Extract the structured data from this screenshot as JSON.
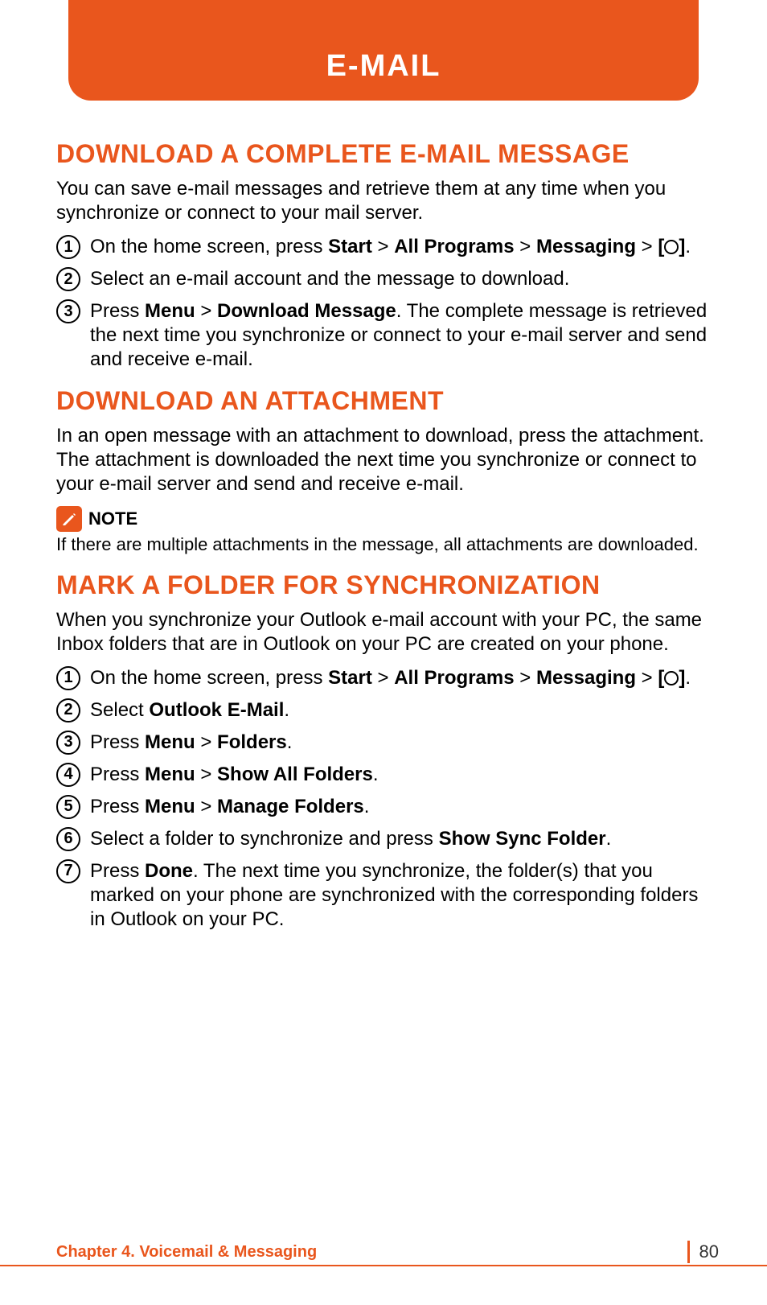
{
  "tab": {
    "title": "E-MAIL"
  },
  "section1": {
    "heading": "DOWNLOAD A COMPLETE E-MAIL MESSAGE",
    "intro": "You can save e-mail messages and retrieve them at any time when you synchronize or connect to your mail server.",
    "steps": [
      {
        "num": "1",
        "parts": [
          "On the home screen, press ",
          "Start",
          " > ",
          "All Programs",
          " > ",
          "Messaging",
          " > ",
          "[",
          "]",
          "."
        ]
      },
      {
        "num": "2",
        "parts": [
          "Select an e-mail account and the message to download."
        ]
      },
      {
        "num": "3",
        "parts": [
          "Press ",
          "Menu",
          " > ",
          "Download Message",
          ". The complete message is retrieved the next time you synchronize or connect to your e-mail server and send and receive e-mail."
        ]
      }
    ]
  },
  "section2": {
    "heading": "DOWNLOAD AN ATTACHMENT",
    "body": "In an open message with an attachment to download, press the attachment. The attachment is downloaded the next time you synchronize or connect to your e-mail server and send and receive e-mail.",
    "note_label": "NOTE",
    "note_text": "If there are multiple attachments in the message, all attachments are downloaded."
  },
  "section3": {
    "heading": "MARK A FOLDER FOR SYNCHRONIZATION",
    "intro": "When you synchronize your Outlook e-mail account with your PC, the same Inbox folders that are in Outlook on your PC are created on your phone.",
    "steps": [
      {
        "num": "1",
        "parts": [
          "On the home screen, press ",
          "Start",
          " > ",
          "All Programs",
          " > ",
          "Messaging",
          " > ",
          "[",
          "]",
          "."
        ]
      },
      {
        "num": "2",
        "parts": [
          "Select ",
          "Outlook E-Mail",
          "."
        ]
      },
      {
        "num": "3",
        "parts": [
          "Press ",
          "Menu",
          " > ",
          "Folders",
          "."
        ]
      },
      {
        "num": "4",
        "parts": [
          "Press ",
          "Menu",
          " > ",
          "Show All Folders",
          "."
        ]
      },
      {
        "num": "5",
        "parts": [
          "Press ",
          "Menu",
          " > ",
          "Manage Folders",
          "."
        ]
      },
      {
        "num": "6",
        "parts": [
          "Select a folder to synchronize and press ",
          "Show Sync Folder",
          "."
        ]
      },
      {
        "num": "7",
        "parts": [
          "Press ",
          "Done",
          ". The next time you synchronize, the folder(s) that you marked on your phone are synchronized with the corresponding folders in Outlook on your PC."
        ]
      }
    ]
  },
  "footer": {
    "chapter": "Chapter 4. Voicemail & Messaging",
    "page": "80"
  }
}
